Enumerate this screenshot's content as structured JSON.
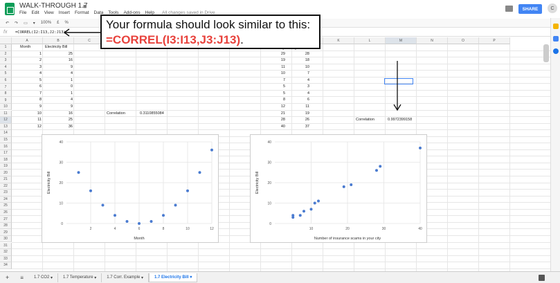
{
  "app": {
    "doc_title": "WALK-THROUGH 1.7",
    "menus": [
      "File",
      "Edit",
      "View",
      "Insert",
      "Format",
      "Data",
      "Tools",
      "Add-ons",
      "Help"
    ],
    "save_status": "All changes saved in Drive",
    "share_label": "SHARE",
    "avatar_initial": "C",
    "colors": {
      "share": "#4285f4",
      "brand": "#0f9d58",
      "accent": "#e8423c",
      "point": "#4a7bd0"
    }
  },
  "toolbar": {
    "zoom": "100%",
    "currency": "£",
    "percent": "%",
    "sigma": "Σ"
  },
  "formula_bar": {
    "fx_label": "fx",
    "formula": "=CORREL(I2:I13,J2:J13)"
  },
  "callout": {
    "line1": "Your formula should look similar to this:",
    "formula": "=CORREL(I3:I13,J3:J13)",
    "period": "."
  },
  "columns": [
    "A",
    "B",
    "C",
    "D",
    "E",
    "F",
    "G",
    "H",
    "I",
    "J",
    "K",
    "L",
    "M",
    "N",
    "O",
    "P"
  ],
  "rows": [
    "1",
    "2",
    "3",
    "4",
    "5",
    "6",
    "7",
    "8",
    "9",
    "10",
    "11",
    "12",
    "13",
    "14",
    "15",
    "16",
    "17",
    "18",
    "19",
    "20",
    "21",
    "22",
    "23",
    "24",
    "25",
    "26",
    "27",
    "28",
    "29",
    "30",
    "31",
    "32",
    "33",
    "34"
  ],
  "table_left": {
    "headers": [
      "Month",
      "Electricity Bill"
    ],
    "rows": [
      [
        1,
        25
      ],
      [
        2,
        16
      ],
      [
        3,
        9
      ],
      [
        4,
        4
      ],
      [
        5,
        1
      ],
      [
        6,
        0
      ],
      [
        7,
        1
      ],
      [
        8,
        4
      ],
      [
        9,
        9
      ],
      [
        10,
        16
      ],
      [
        11,
        25
      ],
      [
        12,
        36
      ]
    ]
  },
  "correlation_left": {
    "label": "Correlation",
    "value": "0.3110855084"
  },
  "table_right": {
    "header": "scams in your city",
    "rows": [
      [
        29,
        28
      ],
      [
        19,
        18
      ],
      [
        11,
        10
      ],
      [
        10,
        7
      ],
      [
        7,
        4
      ],
      [
        5,
        3
      ],
      [
        5,
        4
      ],
      [
        8,
        6
      ],
      [
        12,
        11
      ],
      [
        21,
        19
      ],
      [
        28,
        26
      ],
      [
        40,
        37
      ]
    ]
  },
  "correlation_right": {
    "label": "Correlation",
    "value": "0.9972399158"
  },
  "sheet_tabs": [
    "1.7 CO2",
    "1.7 Temperature",
    "1.7 Corr. Example",
    "1.7 Electricity Bill"
  ],
  "chart_data": [
    {
      "type": "scatter",
      "xlabel": "Month",
      "ylabel": "Electricity Bill",
      "xlim": [
        0,
        12
      ],
      "ylim": [
        0,
        40
      ],
      "xticks": [
        2,
        4,
        6,
        8,
        10,
        12
      ],
      "yticks": [
        0,
        10,
        20,
        30,
        40
      ],
      "grid": true,
      "x": [
        1,
        2,
        3,
        4,
        5,
        6,
        7,
        8,
        9,
        10,
        11,
        12
      ],
      "y": [
        25,
        16,
        9,
        4,
        1,
        0,
        1,
        4,
        9,
        16,
        25,
        36
      ]
    },
    {
      "type": "scatter",
      "xlabel": "Number of insurance scams in your city",
      "ylabel": "Electricity Bill",
      "xlim": [
        0,
        40
      ],
      "ylim": [
        0,
        40
      ],
      "xticks": [
        10,
        20,
        30,
        40
      ],
      "yticks": [
        0,
        10,
        20,
        30,
        40
      ],
      "grid": true,
      "x": [
        29,
        19,
        11,
        10,
        7,
        5,
        5,
        8,
        12,
        21,
        28,
        40
      ],
      "y": [
        28,
        18,
        10,
        7,
        4,
        3,
        4,
        6,
        11,
        19,
        26,
        37
      ]
    }
  ]
}
